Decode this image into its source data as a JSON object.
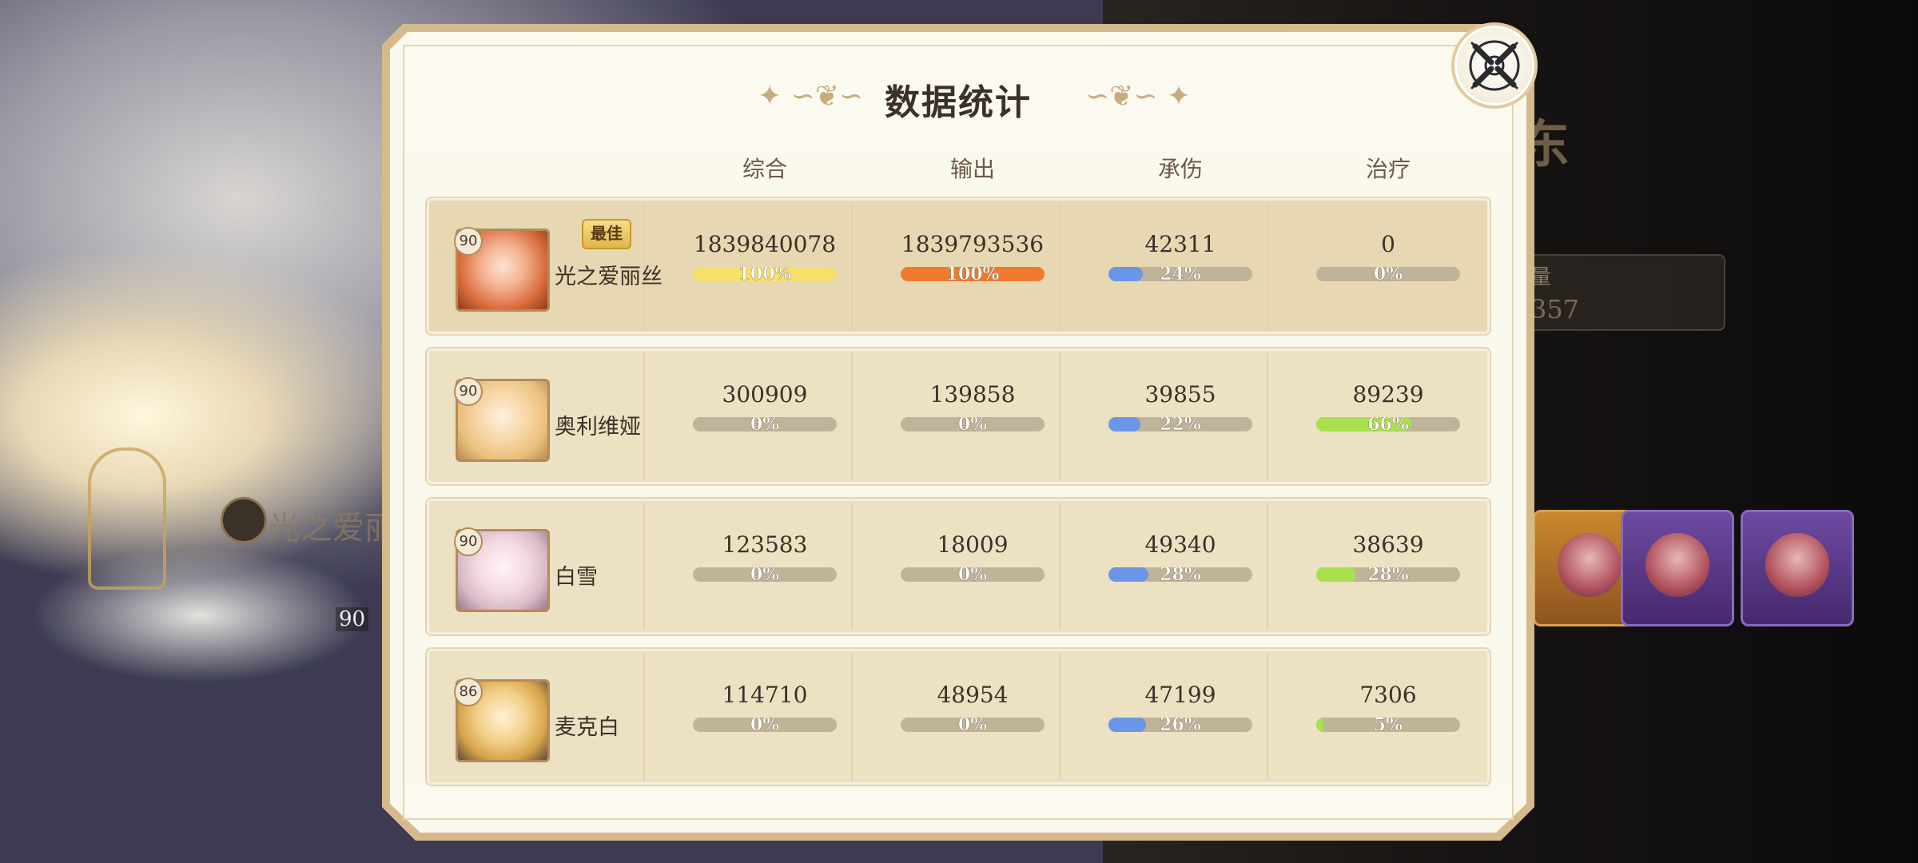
{
  "background": {
    "panel_title": "东",
    "stat_label": "量",
    "stat_value": "357",
    "target_text": "光之爱丽",
    "level": "90"
  },
  "dialog": {
    "title": "数据统计",
    "close_icon": "close-icon",
    "columns": [
      "综合",
      "输出",
      "承伤",
      "治疗"
    ],
    "best_badge": "最佳",
    "colors": {
      "yellow": "#f7e06a",
      "orange": "#ee7a2f",
      "blue": "#6b95e6",
      "green": "#a9e04d",
      "track": "#bfb39a"
    },
    "rows": [
      {
        "level": "90",
        "name": "光之爱丽丝",
        "best": true,
        "stats": [
          {
            "value": "1839840078",
            "pct": "100%",
            "fill": 1.0,
            "color": "#f7e06a"
          },
          {
            "value": "1839793536",
            "pct": "100%",
            "fill": 1.0,
            "color": "#ee7a2f"
          },
          {
            "value": "42311",
            "pct": "24%",
            "fill": 0.24,
            "color": "#6b95e6"
          },
          {
            "value": "0",
            "pct": "0%",
            "fill": 0,
            "color": "#a9e04d"
          }
        ]
      },
      {
        "level": "90",
        "name": "奥利维娅",
        "best": false,
        "stats": [
          {
            "value": "300909",
            "pct": "0%",
            "fill": 0,
            "color": "#f7e06a"
          },
          {
            "value": "139858",
            "pct": "0%",
            "fill": 0,
            "color": "#ee7a2f"
          },
          {
            "value": "39855",
            "pct": "22%",
            "fill": 0.22,
            "color": "#6b95e6"
          },
          {
            "value": "89239",
            "pct": "66%",
            "fill": 0.66,
            "color": "#a9e04d"
          }
        ]
      },
      {
        "level": "90",
        "name": "白雪",
        "best": false,
        "stats": [
          {
            "value": "123583",
            "pct": "0%",
            "fill": 0,
            "color": "#f7e06a"
          },
          {
            "value": "18009",
            "pct": "0%",
            "fill": 0,
            "color": "#ee7a2f"
          },
          {
            "value": "49340",
            "pct": "28%",
            "fill": 0.28,
            "color": "#6b95e6"
          },
          {
            "value": "38639",
            "pct": "28%",
            "fill": 0.28,
            "color": "#a9e04d"
          }
        ]
      },
      {
        "level": "86",
        "name": "麦克白",
        "best": false,
        "stats": [
          {
            "value": "114710",
            "pct": "0%",
            "fill": 0,
            "color": "#f7e06a"
          },
          {
            "value": "48954",
            "pct": "0%",
            "fill": 0,
            "color": "#ee7a2f"
          },
          {
            "value": "47199",
            "pct": "26%",
            "fill": 0.26,
            "color": "#6b95e6"
          },
          {
            "value": "7306",
            "pct": "5%",
            "fill": 0.05,
            "color": "#a9e04d"
          }
        ]
      }
    ]
  }
}
